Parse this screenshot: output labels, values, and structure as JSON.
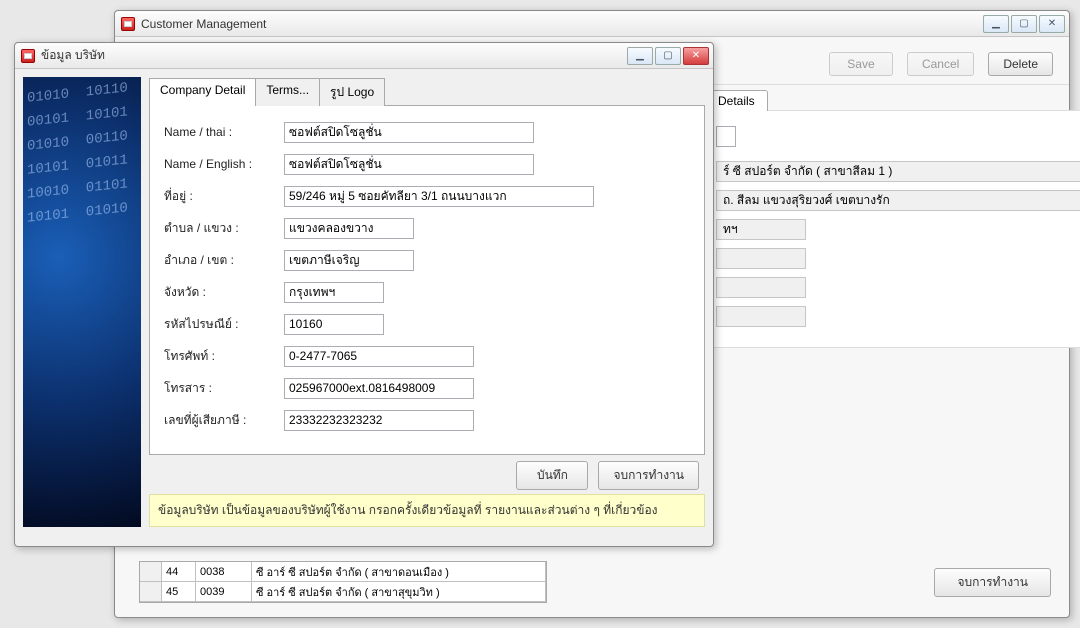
{
  "main": {
    "title": "Customer Management",
    "toolbar": {
      "save_label": "Save",
      "cancel_label": "Cancel",
      "delete_label": "Delete"
    },
    "side_tab": "Details",
    "readonly1": "ร์  ซี  สปอร์ต  จำกัด ( สาขาสีลม 1 )",
    "readonly2": "ถ. สีลม  แขวงสุริยวงศ์  เขตบางรัก",
    "readonly3": "ทฯ",
    "grid": {
      "rows": [
        {
          "n": "44",
          "code": "0038",
          "name": "ซี  อาร์  ซี  สปอร์ต  จำกัด  ( สาขาดอนเมือง )"
        },
        {
          "n": "45",
          "code": "0039",
          "name": "ซี  อาร์  ซี  สปอร์ต  จำกัด  ( สาขาสุขุมวิท )"
        }
      ]
    },
    "end_label": "จบการทำงาน"
  },
  "dialog": {
    "title": "ข้อมูล บริษัท",
    "tabs": {
      "company": "Company Detail",
      "terms": "Terms...",
      "logo": "รูป Logo"
    },
    "labels": {
      "name_th": "Name / thai :",
      "name_en": "Name / English :",
      "address": "ที่อยู่ :",
      "tambol": "ตำบล / แขวง :",
      "amphoe": "อำเภอ / เขต :",
      "province": "จังหวัด :",
      "postcode": "รหัสไปรษณีย์ :",
      "phone": "โทรศัพท์ :",
      "fax": "โทรสาร :",
      "tax": "เลขที่ผู้เสียภาษี :"
    },
    "values": {
      "name_th": "ซอฟต์สปิดโซลูชั่น",
      "name_en": "ซอฟต์สปิดโซลูชั่น",
      "address": "59/246 หมู่ 5 ซอยคัทลียา 3/1 ถนนบางแวก",
      "tambol": "แขวงคลองขวาง",
      "amphoe": "เขตภาษีเจริญ",
      "province": "กรุงเทพฯ",
      "postcode": "10160",
      "phone": "0-2477-7065",
      "fax": "025967000ext.0816498009",
      "tax": "23332232323232"
    },
    "save_label": "บันทึก",
    "end_label": "จบการทำงาน",
    "footnote": "ข้อมูลบริษัท เป็นข้อมูลของบริษัทผู้ใช้งาน กรอกครั้งเดียวข้อมูลที่ รายงานและส่วนต่าง ๆ ที่เกี่ยวข้อง"
  }
}
